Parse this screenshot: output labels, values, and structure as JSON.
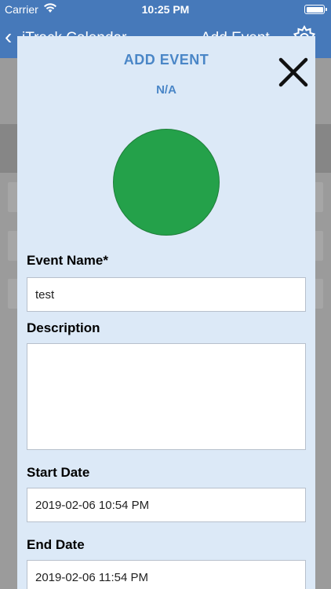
{
  "status_bar": {
    "carrier": "Carrier",
    "time": "10:25 PM"
  },
  "nav": {
    "back_glyph": "‹",
    "title": "iTrack Calendar",
    "action": "Add Event",
    "settings_icon": "gear-icon"
  },
  "modal": {
    "title": "ADD EVENT",
    "subtitle": "N/A",
    "close_icon": "close-icon",
    "color": "#24a14a",
    "fields": {
      "event_name": {
        "label": "Event Name*",
        "value": "test"
      },
      "description": {
        "label": "Description",
        "value": ""
      },
      "start_date": {
        "label": "Start Date",
        "value": "2019-02-06 10:54 PM"
      },
      "end_date": {
        "label": "End Date",
        "value": "2019-02-06 11:54 PM"
      }
    }
  },
  "colors": {
    "header": "#4679ba",
    "modal_bg": "#dce9f7",
    "accent_text": "#4a86c7",
    "event_color": "#24a14a"
  }
}
